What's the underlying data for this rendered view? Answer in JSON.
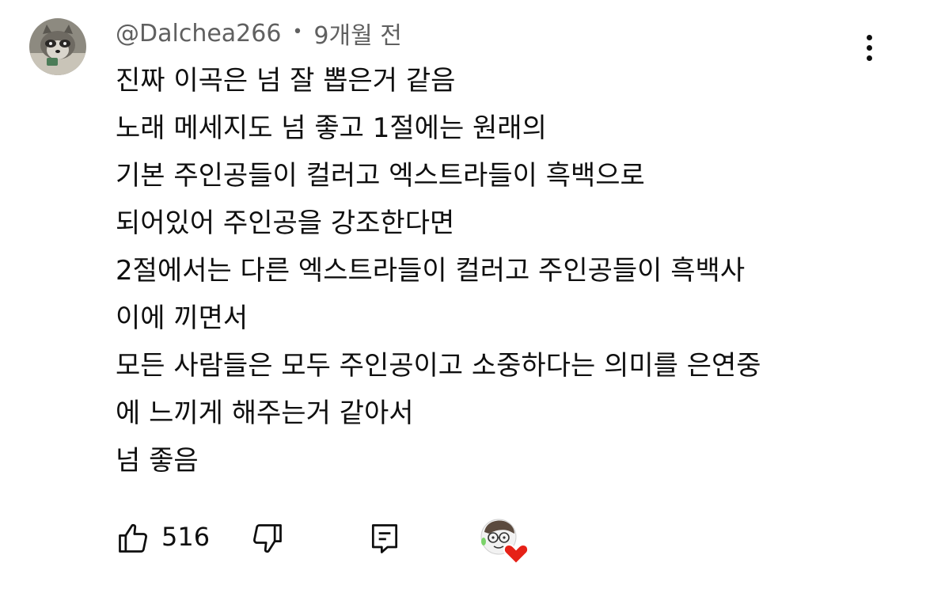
{
  "comment": {
    "author": "@Dalchea266",
    "separator": "•",
    "timestamp": "9개월 전",
    "avatar_icon": "raccoon-avatar-icon",
    "more_icon": "more-vert-icon",
    "lines": [
      "진짜 이곡은 넘 잘 뽑은거 같음",
      "노래 메세지도 넘 좋고 1절에는 원래의",
      "기본 주인공들이 컬러고 엑스트라들이 흑백으로",
      "되어있어 주인공을 강조한다면",
      "2절에서는 다른 엑스트라들이 컬러고 주인공들이 흑백사",
      "이에 끼면서",
      "모든 사람들은 모두 주인공이고 소중하다는 의미를 은연중",
      "에 느끼게 해주는거 같아서",
      "넘 좋음"
    ]
  },
  "actions": {
    "like_icon": "thumbs-up-icon",
    "like_count": "516",
    "dislike_icon": "thumbs-down-icon",
    "reply_icon": "reply-comment-icon",
    "creator_heart_icon": "creator-heart-icon",
    "heart_color": "#e62117"
  }
}
